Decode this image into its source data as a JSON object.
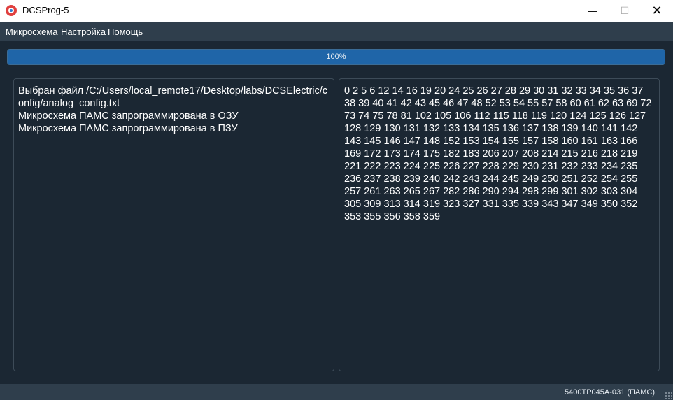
{
  "window": {
    "title": "DCSProg-5",
    "minimize_glyph": "—",
    "maximize_glyph": "☐",
    "close_glyph": "✕"
  },
  "menu": {
    "items": [
      {
        "label": "Микросхема"
      },
      {
        "label": "Настройка"
      },
      {
        "label": "Помощь"
      }
    ]
  },
  "progress": {
    "value": 100,
    "label": "100%"
  },
  "log": {
    "lines": [
      "Выбран файл /C:/Users/local_remote17/Desktop/labs/DCSElectric/config/analog_config.txt",
      "Микросхема ПАМС запрограммирована в ОЗУ",
      "Микросхема ПАМС запрограммирована в ПЗУ"
    ]
  },
  "addresses": {
    "text": "0 2 5 6 12 14 16 19 20 24 25 26 27 28 29 30 31 32 33 34 35 36 37 38 39 40 41 42 43 45 46 47 48 52 53 54 55 57 58 60 61 62 63 69 72 73 74 75 78 81 102 105 106 112 115 118 119 120 124 125 126 127 128 129 130 131 132 133 134 135 136 137 138 139 140 141 142 143 145 146 147 148 152 153 154 155 157 158 160 161 163 166 169 172 173 174 175 182 183 206 207 208 214 215 216 218 219 221 222 223 224 225 226 227 228 229 230 231 232 233 234 235 236 237 238 239 240 242 243 244 245 249 250 251 252 254 255 257 261 263 265 267 282 286 290 294 298 299 301 302 303 304 305 309 313 314 319 323 327 331 335 339 343 347 349 350 352 353 355 356 358 359"
  },
  "status": {
    "chip": "5400TP045A-031 (ПАМС)"
  },
  "colors": {
    "background": "#1b2733",
    "menubar": "#2f3e4c",
    "progress_fill": "#1f65a8",
    "panel_border": "#3d4b58"
  }
}
